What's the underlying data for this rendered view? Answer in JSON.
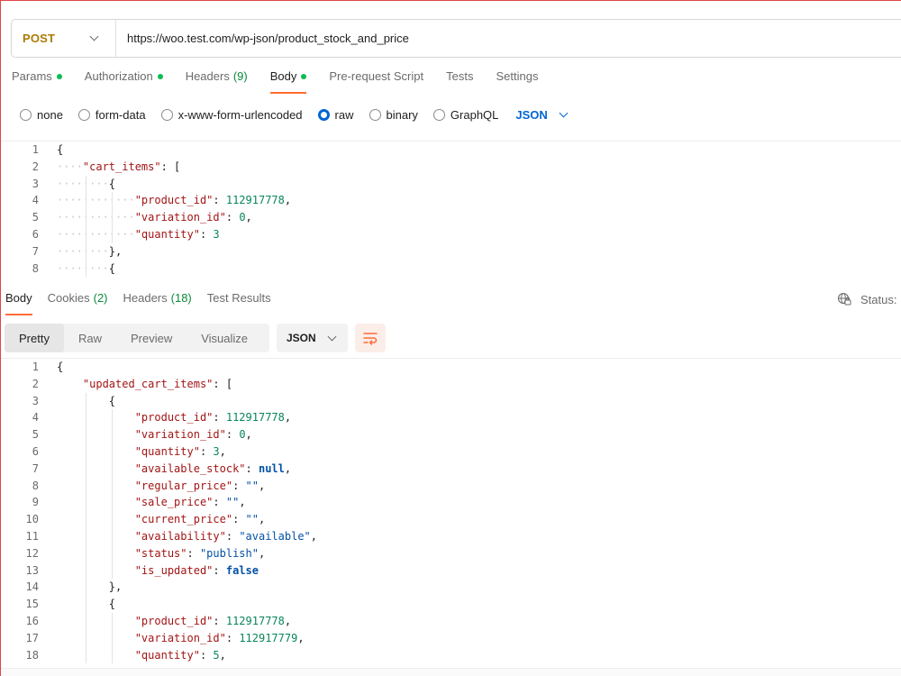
{
  "request": {
    "method": "POST",
    "url": "https://woo.test.com/wp-json/product_stock_and_price"
  },
  "request_tabs": [
    {
      "label": "Params",
      "dot": true,
      "active": false
    },
    {
      "label": "Authorization",
      "dot": true,
      "active": false
    },
    {
      "label": "Headers",
      "count": "(9)",
      "active": false
    },
    {
      "label": "Body",
      "dot": true,
      "active": true
    },
    {
      "label": "Pre-request Script",
      "active": false
    },
    {
      "label": "Tests",
      "active": false
    },
    {
      "label": "Settings",
      "active": false
    }
  ],
  "body_types": {
    "options": [
      "none",
      "form-data",
      "x-www-form-urlencoded",
      "raw",
      "binary",
      "GraphQL"
    ],
    "selected": "raw",
    "language": "JSON"
  },
  "request_code": [
    {
      "n": "1",
      "i": 0,
      "t": [
        [
          "p",
          "{"
        ]
      ]
    },
    {
      "n": "2",
      "i": 1,
      "t": [
        [
          "k",
          "\"cart_items\""
        ],
        [
          "p",
          ": ["
        ]
      ]
    },
    {
      "n": "3",
      "i": 2,
      "t": [
        [
          "p",
          "{"
        ]
      ]
    },
    {
      "n": "4",
      "i": 3,
      "t": [
        [
          "k",
          "\"product_id\""
        ],
        [
          "p",
          ": "
        ],
        [
          "n",
          "112917778"
        ],
        [
          "p",
          ","
        ]
      ]
    },
    {
      "n": "5",
      "i": 3,
      "t": [
        [
          "k",
          "\"variation_id\""
        ],
        [
          "p",
          ": "
        ],
        [
          "n",
          "0"
        ],
        [
          "p",
          ","
        ]
      ]
    },
    {
      "n": "6",
      "i": 3,
      "t": [
        [
          "k",
          "\"quantity\""
        ],
        [
          "p",
          ": "
        ],
        [
          "n",
          "3"
        ]
      ]
    },
    {
      "n": "7",
      "i": 2,
      "t": [
        [
          "p",
          "},"
        ]
      ]
    },
    {
      "n": "8",
      "i": 2,
      "t": [
        [
          "p",
          "{"
        ]
      ]
    }
  ],
  "response_tabs": [
    {
      "label": "Body",
      "active": true
    },
    {
      "label": "Cookies",
      "count": "(2)",
      "active": false
    },
    {
      "label": "Headers",
      "count": "(18)",
      "active": false
    },
    {
      "label": "Test Results",
      "active": false
    }
  ],
  "response_status_label": "Status:",
  "view_modes": [
    "Pretty",
    "Raw",
    "Preview",
    "Visualize"
  ],
  "view_selected": "Pretty",
  "response_language": "JSON",
  "response_code": [
    {
      "n": "1",
      "i": 0,
      "t": [
        [
          "p",
          "{"
        ]
      ]
    },
    {
      "n": "2",
      "i": 1,
      "t": [
        [
          "k",
          "\"updated_cart_items\""
        ],
        [
          "p",
          ": ["
        ]
      ]
    },
    {
      "n": "3",
      "i": 2,
      "t": [
        [
          "p",
          "{"
        ]
      ]
    },
    {
      "n": "4",
      "i": 3,
      "t": [
        [
          "k",
          "\"product_id\""
        ],
        [
          "p",
          ": "
        ],
        [
          "n",
          "112917778"
        ],
        [
          "p",
          ","
        ]
      ]
    },
    {
      "n": "5",
      "i": 3,
      "t": [
        [
          "k",
          "\"variation_id\""
        ],
        [
          "p",
          ": "
        ],
        [
          "n",
          "0"
        ],
        [
          "p",
          ","
        ]
      ]
    },
    {
      "n": "6",
      "i": 3,
      "t": [
        [
          "k",
          "\"quantity\""
        ],
        [
          "p",
          ": "
        ],
        [
          "n",
          "3"
        ],
        [
          "p",
          ","
        ]
      ]
    },
    {
      "n": "7",
      "i": 3,
      "t": [
        [
          "k",
          "\"available_stock\""
        ],
        [
          "p",
          ": "
        ],
        [
          "w",
          "null"
        ],
        [
          "p",
          ","
        ]
      ]
    },
    {
      "n": "8",
      "i": 3,
      "t": [
        [
          "k",
          "\"regular_price\""
        ],
        [
          "p",
          ": "
        ],
        [
          "s",
          "\"\""
        ],
        [
          "p",
          ","
        ]
      ]
    },
    {
      "n": "9",
      "i": 3,
      "t": [
        [
          "k",
          "\"sale_price\""
        ],
        [
          "p",
          ": "
        ],
        [
          "s",
          "\"\""
        ],
        [
          "p",
          ","
        ]
      ]
    },
    {
      "n": "10",
      "i": 3,
      "t": [
        [
          "k",
          "\"current_price\""
        ],
        [
          "p",
          ": "
        ],
        [
          "s",
          "\"\""
        ],
        [
          "p",
          ","
        ]
      ]
    },
    {
      "n": "11",
      "i": 3,
      "t": [
        [
          "k",
          "\"availability\""
        ],
        [
          "p",
          ": "
        ],
        [
          "s",
          "\"available\""
        ],
        [
          "p",
          ","
        ]
      ]
    },
    {
      "n": "12",
      "i": 3,
      "t": [
        [
          "k",
          "\"status\""
        ],
        [
          "p",
          ": "
        ],
        [
          "s",
          "\"publish\""
        ],
        [
          "p",
          ","
        ]
      ]
    },
    {
      "n": "13",
      "i": 3,
      "t": [
        [
          "k",
          "\"is_updated\""
        ],
        [
          "p",
          ": "
        ],
        [
          "w",
          "false"
        ]
      ]
    },
    {
      "n": "14",
      "i": 2,
      "t": [
        [
          "p",
          "},"
        ]
      ]
    },
    {
      "n": "15",
      "i": 2,
      "t": [
        [
          "p",
          "{"
        ]
      ]
    },
    {
      "n": "16",
      "i": 3,
      "t": [
        [
          "k",
          "\"product_id\""
        ],
        [
          "p",
          ": "
        ],
        [
          "n",
          "112917778"
        ],
        [
          "p",
          ","
        ]
      ]
    },
    {
      "n": "17",
      "i": 3,
      "t": [
        [
          "k",
          "\"variation_id\""
        ],
        [
          "p",
          ": "
        ],
        [
          "n",
          "112917779"
        ],
        [
          "p",
          ","
        ]
      ]
    },
    {
      "n": "18",
      "i": 3,
      "t": [
        [
          "k",
          "\"quantity\""
        ],
        [
          "p",
          ": "
        ],
        [
          "n",
          "5"
        ],
        [
          "p",
          ","
        ]
      ]
    }
  ],
  "colors": {
    "accent": "#ff6c37",
    "method": "#ad7a03",
    "link_blue": "#0265d2",
    "key": "#a31515",
    "string": "#0451a5",
    "number": "#098658",
    "dot_green": "#0cbb52"
  }
}
